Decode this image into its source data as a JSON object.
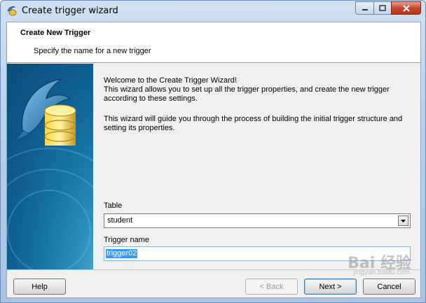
{
  "window": {
    "title": "Create trigger wizard",
    "accent": "#2e6ea6"
  },
  "header": {
    "title": "Create New Trigger",
    "subtitle": "Specify the name for a new trigger"
  },
  "intro": {
    "line1": "Welcome to the Create Trigger Wizard!",
    "line2": "This wizard allows you to set up all the trigger properties, and create the new trigger according to these settings.",
    "line3": "This wizard will guide you through the process of building the initial trigger structure and setting its properties."
  },
  "table_field": {
    "label": "Table",
    "value": "student"
  },
  "trigger_name_field": {
    "label": "Trigger name",
    "value": "trigger02"
  },
  "buttons": {
    "help": "Help",
    "back": "< Back",
    "next": "Next >",
    "cancel": "Cancel"
  },
  "icons": {
    "app": "dolphin-db-icon",
    "sidebar": "dolphin-database-logo"
  },
  "watermark": {
    "brand": "Bai",
    "cn": "经验",
    "url": "jingyan.baidu.com"
  }
}
